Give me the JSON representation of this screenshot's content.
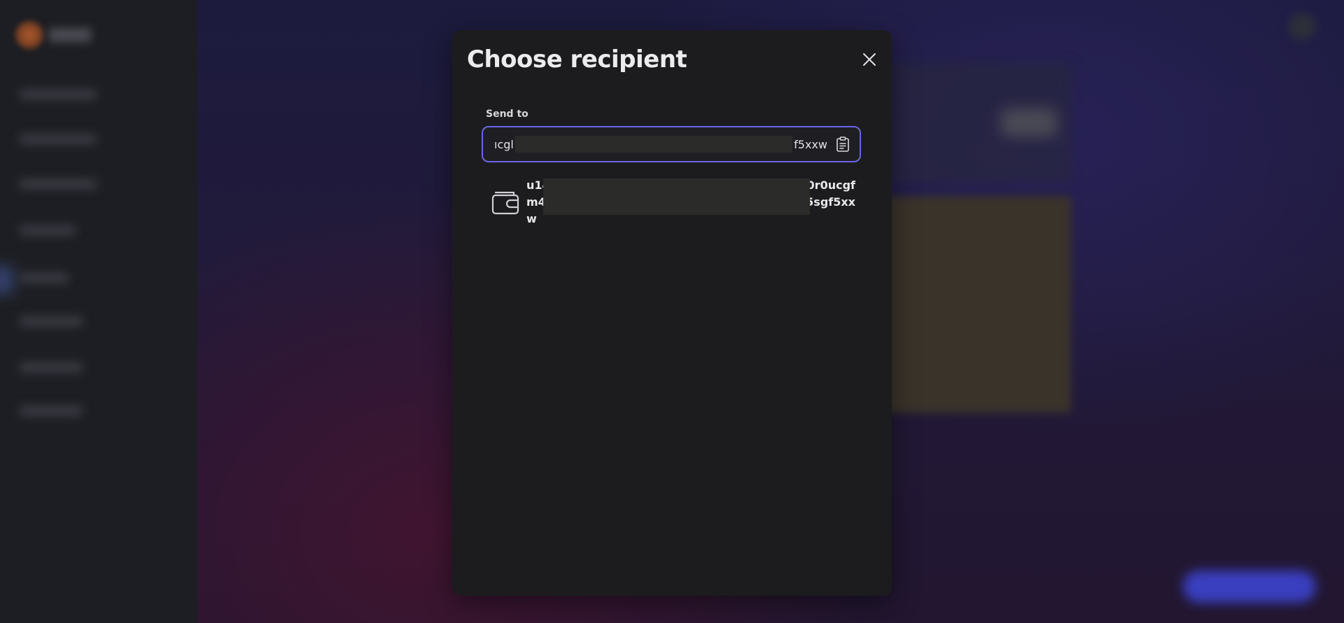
{
  "modal": {
    "title": "Choose recipient",
    "send_to_label": "Send to",
    "input": {
      "value_start": "ıcgl",
      "value_end": "f5xxw"
    },
    "suggestion": {
      "line1_start": "u14",
      "line1_end": "0r0ucgf",
      "line2_start": "m4",
      "line2_end": "5sgf5xx",
      "line3": "w"
    }
  },
  "icons": {
    "close": "close-icon",
    "paste": "clipboard-icon",
    "wallet": "wallet-icon"
  },
  "colors": {
    "accent": "#6b64e8",
    "modal_bg": "#1c1c1f",
    "text": "#ececef"
  }
}
